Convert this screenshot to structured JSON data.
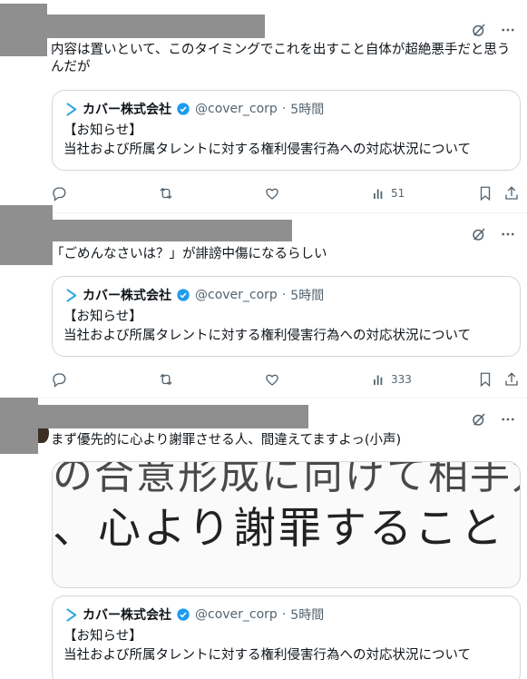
{
  "colors": {
    "text": "#0f1419",
    "muted": "#536471",
    "border": "#cfd9de",
    "verified": "#1d9bf0",
    "redaction": "#8f8f90",
    "cover_blue": "#2fa9e0"
  },
  "posts": [
    {
      "text": "内容は置いといて、このタイミングでこれを出すこと自体が超絶悪手だと思うんだが",
      "quote": {
        "name": "カバー株式会社",
        "handle": "@cover_corp",
        "dot": "·",
        "time": "5時間",
        "line1": "【お知らせ】",
        "line2": "当社および所属タレントに対する権利侵害行為への対応状況について"
      },
      "views": "51"
    },
    {
      "text": "「ごめんなさいは？」が誹謗中傷になるらしい",
      "quote": {
        "name": "カバー株式会社",
        "handle": "@cover_corp",
        "dot": "·",
        "time": "5時間",
        "line1": "【お知らせ】",
        "line2": "当社および所属タレントに対する権利侵害行為への対応状況について"
      },
      "views": "333"
    },
    {
      "text": "まず優先的に心より謝罪させる人、間違えてますよっ(小声)",
      "media": {
        "top_text": "の合意形成に向けて相手方",
        "main_text": "、心より謝罪すること"
      },
      "quote": {
        "name": "カバー株式会社",
        "handle": "@cover_corp",
        "dot": "·",
        "time": "5時間",
        "line1": "【お知らせ】",
        "line2": "当社および所属タレントに対する権利侵害行為への対応状況について"
      }
    }
  ],
  "icons": {
    "grok": "grok-icon",
    "more": "more-icon",
    "reply": "reply-icon",
    "retweet": "retweet-icon",
    "like": "heart-icon",
    "views": "views-icon",
    "bookmark": "bookmark-icon",
    "share": "share-icon",
    "verified": "verified-badge-icon",
    "cover_logo": "cover-logo-icon"
  }
}
